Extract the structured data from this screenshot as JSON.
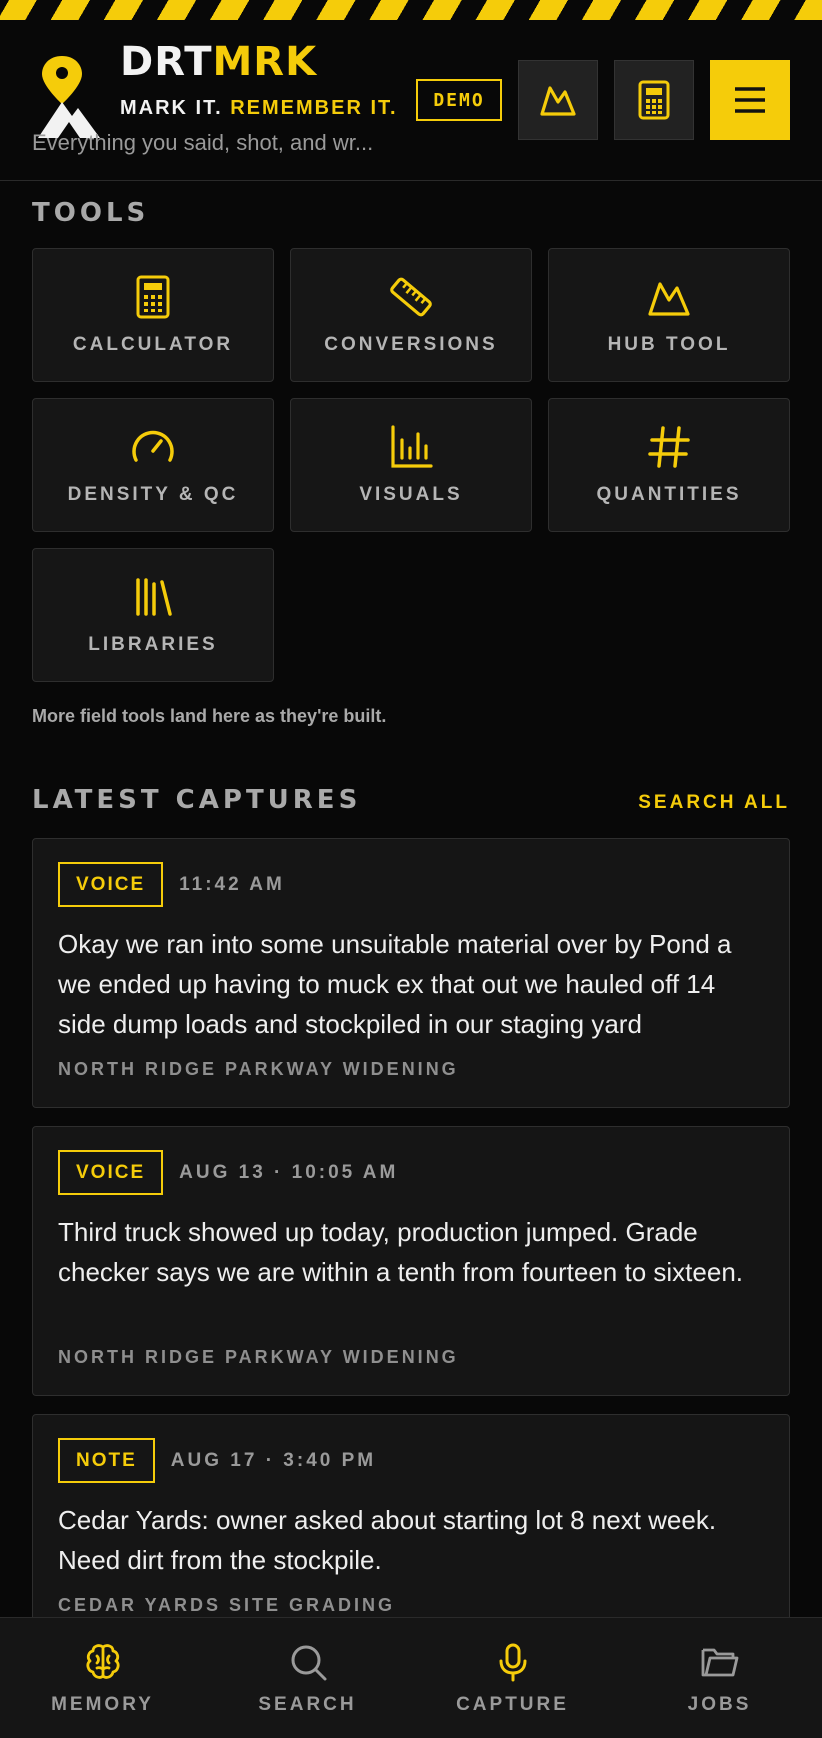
{
  "header": {
    "brand_part1": "DRT",
    "brand_part2": "MRK",
    "tagline_part1": "MARK IT.",
    "tagline_part2": "REMEMBER IT.",
    "subtitle": "Everything you said, shot, and wr...",
    "demo_label": "DEMO"
  },
  "tools": {
    "title": "TOOLS",
    "items": [
      {
        "label": "CALCULATOR",
        "icon": "calculator-icon"
      },
      {
        "label": "CONVERSIONS",
        "icon": "ruler-icon"
      },
      {
        "label": "HUB TOOL",
        "icon": "mountain-icon"
      },
      {
        "label": "DENSITY & QC",
        "icon": "gauge-icon"
      },
      {
        "label": "VISUALS",
        "icon": "bar-chart-icon"
      },
      {
        "label": "QUANTITIES",
        "icon": "hash-icon"
      },
      {
        "label": "LIBRARIES",
        "icon": "library-icon"
      }
    ],
    "footnote": "More field tools land here as they're built."
  },
  "captures": {
    "title": "LATEST CAPTURES",
    "search_all": "SEARCH ALL",
    "items": [
      {
        "type": "VOICE",
        "time": "11:42 AM",
        "body": "Okay we ran into some unsuitable material over by Pond a we ended up having to muck ex that out we hauled off 14 side dump loads and stockpiled in our staging yard",
        "project": "NORTH RIDGE PARKWAY WIDENING"
      },
      {
        "type": "VOICE",
        "time": "AUG 13 · 10:05 AM",
        "body": "Third truck showed up today, production jumped. Grade checker says we are within a tenth from fourteen to sixteen.",
        "project": "NORTH RIDGE PARKWAY WIDENING"
      },
      {
        "type": "NOTE",
        "time": "AUG 17 · 3:40 PM",
        "body": "Cedar Yards: owner asked about starting lot 8 next week. Need dirt from the stockpile.",
        "project": "CEDAR YARDS SITE GRADING"
      }
    ]
  },
  "nav": {
    "items": [
      {
        "label": "MEMORY",
        "icon": "brain-icon",
        "active": true
      },
      {
        "label": "SEARCH",
        "icon": "search-icon",
        "active": false
      },
      {
        "label": "CAPTURE",
        "icon": "microphone-icon",
        "active": true
      },
      {
        "label": "JOBS",
        "icon": "folder-icon",
        "active": false
      }
    ]
  },
  "colors": {
    "accent": "#f5cc0a",
    "background": "#080808",
    "card": "#151515"
  }
}
